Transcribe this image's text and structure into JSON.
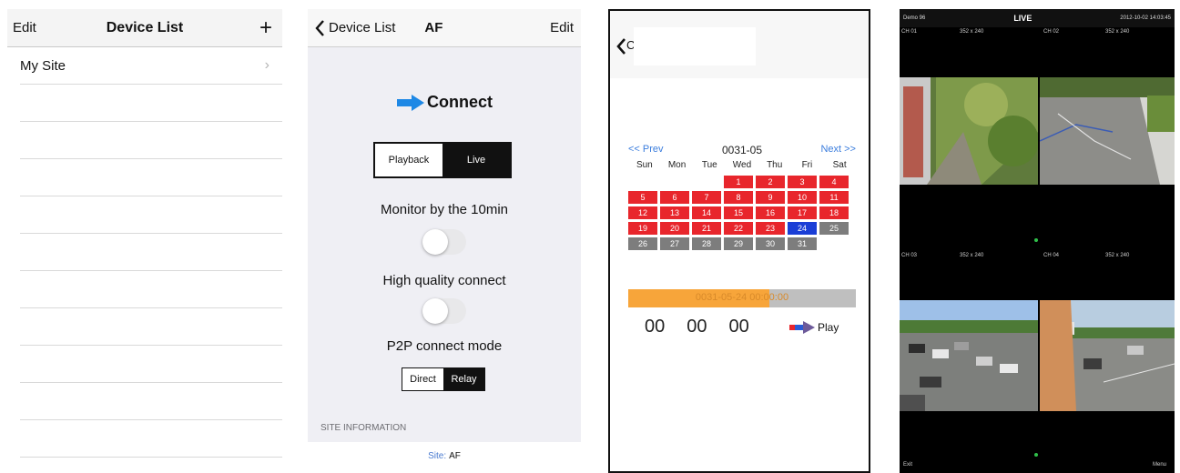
{
  "panel1": {
    "nav": {
      "edit": "Edit",
      "title": "Device List",
      "add": "+"
    },
    "rows": [
      {
        "label": "My Site",
        "chevron": "›"
      },
      {
        "label": ""
      },
      {
        "label": ""
      },
      {
        "label": ""
      },
      {
        "label": ""
      },
      {
        "label": ""
      },
      {
        "label": ""
      },
      {
        "label": ""
      },
      {
        "label": ""
      },
      {
        "label": ""
      },
      {
        "label": ""
      }
    ]
  },
  "panel2": {
    "nav": {
      "back": "Device List",
      "title": "AF",
      "edit": "Edit"
    },
    "connect": "Connect",
    "mode_segment": {
      "left": "Playback",
      "right": "Live",
      "selected": "Live"
    },
    "monitor_label": "Monitor by the 10min",
    "monitor_toggle": "off",
    "hq_label": "High quality connect",
    "hq_toggle": "off",
    "p2p_label": "P2P connect mode",
    "p2p_segment": {
      "left": "Direct",
      "right": "Relay",
      "selected": "Relay"
    },
    "section_title": "SITE INFORMATION",
    "site_key": "Site:",
    "site_value": "AF",
    "colors": {
      "accent_blue": "#1e88e5"
    }
  },
  "panel3": {
    "nav": {
      "back": "<",
      "back_text": "C"
    },
    "prev": "<< Prev",
    "next": "Next >>",
    "month": "0031-05",
    "weekdays": [
      "Sun",
      "Mon",
      "Tue",
      "Wed",
      "Thu",
      "Fri",
      "Sat"
    ],
    "days": [
      {
        "d": "",
        "s": "e"
      },
      {
        "d": "",
        "s": "e"
      },
      {
        "d": "",
        "s": "e"
      },
      {
        "d": "1",
        "s": "r"
      },
      {
        "d": "2",
        "s": "r"
      },
      {
        "d": "3",
        "s": "r"
      },
      {
        "d": "4",
        "s": "r"
      },
      {
        "d": "5",
        "s": "r"
      },
      {
        "d": "6",
        "s": "r"
      },
      {
        "d": "7",
        "s": "r"
      },
      {
        "d": "8",
        "s": "r"
      },
      {
        "d": "9",
        "s": "r"
      },
      {
        "d": "10",
        "s": "r"
      },
      {
        "d": "11",
        "s": "r"
      },
      {
        "d": "12",
        "s": "r"
      },
      {
        "d": "13",
        "s": "r"
      },
      {
        "d": "14",
        "s": "r"
      },
      {
        "d": "15",
        "s": "r"
      },
      {
        "d": "16",
        "s": "r"
      },
      {
        "d": "17",
        "s": "r"
      },
      {
        "d": "18",
        "s": "r"
      },
      {
        "d": "19",
        "s": "r"
      },
      {
        "d": "20",
        "s": "r"
      },
      {
        "d": "21",
        "s": "r"
      },
      {
        "d": "22",
        "s": "r"
      },
      {
        "d": "23",
        "s": "r"
      },
      {
        "d": "24",
        "s": "b"
      },
      {
        "d": "25",
        "s": "g"
      },
      {
        "d": "26",
        "s": "g"
      },
      {
        "d": "27",
        "s": "g"
      },
      {
        "d": "28",
        "s": "g"
      },
      {
        "d": "29",
        "s": "g"
      },
      {
        "d": "30",
        "s": "g"
      },
      {
        "d": "31",
        "s": "g"
      }
    ],
    "timeline_label": "0031-05-24 00:00:00",
    "timeline_progress": 0.62,
    "hour": "00",
    "minute": "00",
    "second": "00",
    "play": "Play"
  },
  "panel4": {
    "top_left": "Demo 96",
    "top_title": "LIVE",
    "top_right": "2012-10-02 14:03:45",
    "channels": [
      {
        "name": "CH 01",
        "res": "352 x 240"
      },
      {
        "name": "CH 02",
        "res": "352 x 240"
      },
      {
        "name": "CH 03",
        "res": "352 x 240"
      },
      {
        "name": "CH 04",
        "res": "352 x 240"
      }
    ],
    "bottom_left": "Exit",
    "bottom_right": "Menu"
  }
}
